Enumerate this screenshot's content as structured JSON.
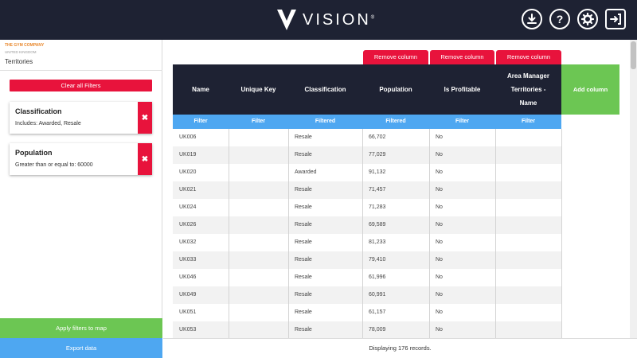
{
  "header": {
    "logo_text": "VISION",
    "logo_mark": "®",
    "icons": [
      "download-icon",
      "help-icon",
      "gear-icon",
      "logout-icon"
    ],
    "help_glyph": "?"
  },
  "sidebar": {
    "company": "THE GYM COMPANY",
    "country": "UNITED KINGDOM",
    "breadcrumb": "Territories",
    "clear_filters_label": "Clear all Filters",
    "filters": [
      {
        "title": "Classification",
        "description": "Includes: Awarded, Resale",
        "remove_glyph": "✖"
      },
      {
        "title": "Population",
        "description": "Greater than or equal to: 60000",
        "remove_glyph": "✖"
      }
    ],
    "apply_label": "Apply filters to map",
    "export_label": "Export data"
  },
  "table": {
    "remove_column_label": "Remove column",
    "add_column_label": "Add column",
    "columns": [
      {
        "header": "Name",
        "filter": "Filter"
      },
      {
        "header": "Unique Key",
        "filter": "Filter"
      },
      {
        "header": "Classification",
        "filter": "Filtered"
      },
      {
        "header": "Population",
        "filter": "Filtered"
      },
      {
        "header": "Is Profitable",
        "filter": "Filter"
      },
      {
        "header": "Area Manager Territories - Name",
        "filter": "Filter"
      }
    ],
    "rows": [
      [
        "UK006",
        "",
        "Resale",
        "66,702",
        "No",
        ""
      ],
      [
        "UK019",
        "",
        "Resale",
        "77,029",
        "No",
        ""
      ],
      [
        "UK020",
        "",
        "Awarded",
        "91,132",
        "No",
        ""
      ],
      [
        "UK021",
        "",
        "Resale",
        "71,457",
        "No",
        ""
      ],
      [
        "UK024",
        "",
        "Resale",
        "71,283",
        "No",
        ""
      ],
      [
        "UK026",
        "",
        "Resale",
        "69,589",
        "No",
        ""
      ],
      [
        "UK032",
        "",
        "Resale",
        "81,233",
        "No",
        ""
      ],
      [
        "UK033",
        "",
        "Resale",
        "79,410",
        "No",
        ""
      ],
      [
        "UK046",
        "",
        "Resale",
        "61,996",
        "No",
        ""
      ],
      [
        "UK049",
        "",
        "Resale",
        "60,991",
        "No",
        ""
      ],
      [
        "UK051",
        "",
        "Resale",
        "61,157",
        "No",
        ""
      ],
      [
        "UK053",
        "",
        "Resale",
        "78,009",
        "No",
        ""
      ]
    ],
    "footer_text": "Displaying 176 records."
  },
  "colors": {
    "navy": "#1e2233",
    "red": "#e8133c",
    "green": "#6cc653",
    "blue": "#4ea7f1",
    "orange": "#e8862a"
  }
}
